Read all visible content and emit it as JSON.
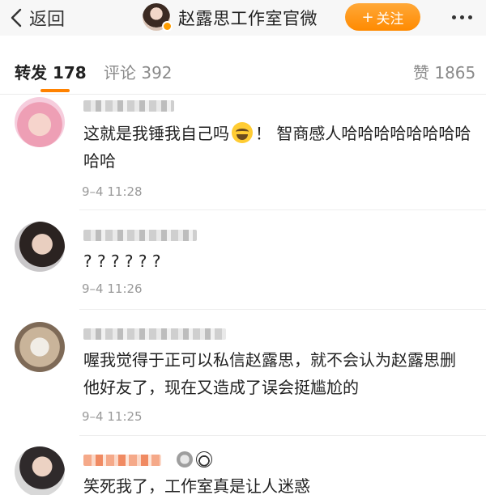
{
  "header": {
    "back_label": "返回",
    "account_name": "赵露思工作室官微",
    "follow_label": "关注",
    "follow_plus": "+"
  },
  "tabs": [
    {
      "label": "转发 178",
      "active": true
    },
    {
      "label": "评论 392",
      "active": false
    },
    {
      "label": "赞 1865",
      "active": false
    }
  ],
  "comments": [
    {
      "text_part1": "这就是我锤我自己吗",
      "emoji": "laugh-cry-emoji",
      "text_part2": "！ 智商感人哈哈哈哈哈哈哈哈哈哈",
      "time": "9–4 11:28"
    },
    {
      "text": "? ? ? ? ? ?",
      "time": "9–4 11:26"
    },
    {
      "text": "喔我觉得于正可以私信赵露思，就不会认为赵露思删他好友了，现在又造成了误会挺尴尬的",
      "time": "9–4 11:25"
    },
    {
      "text": "笑死我了，工作室真是让人迷惑"
    }
  ],
  "colors": {
    "accent": "#ff8200",
    "follow_button": "#ff9a1f"
  }
}
